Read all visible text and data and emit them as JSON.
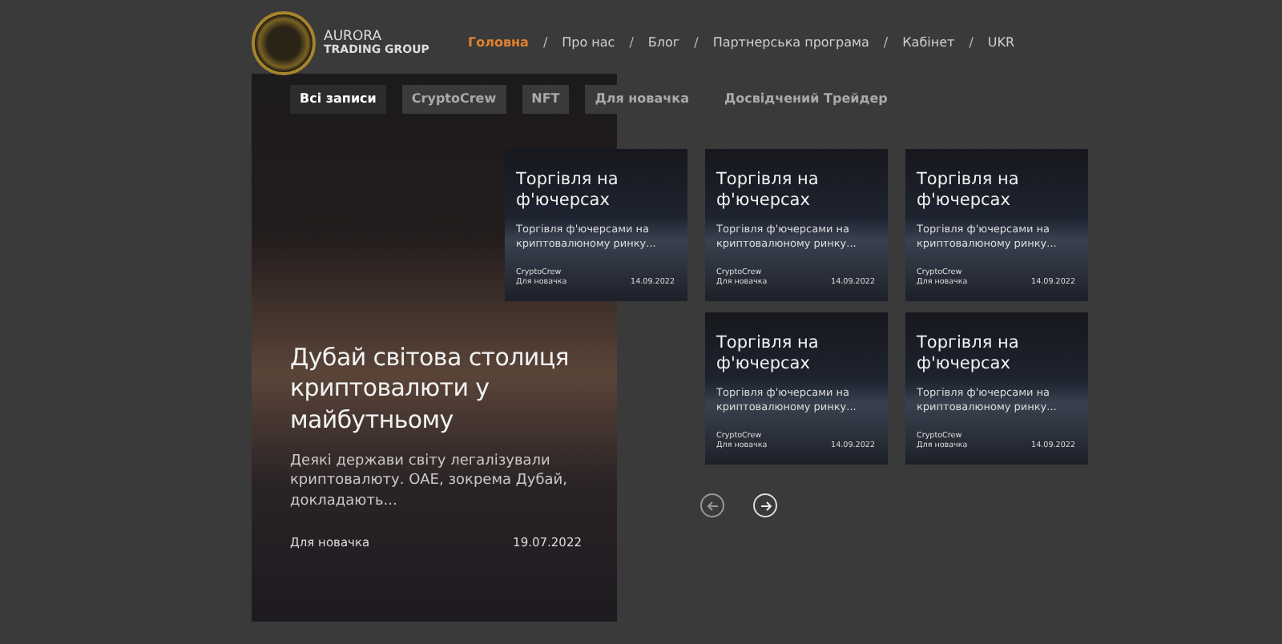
{
  "brand": {
    "name": "AURORA",
    "subtitle": "TRADING GROUP"
  },
  "nav": [
    {
      "kind": "link",
      "label": "Головна",
      "selected": true
    },
    {
      "kind": "separator",
      "label": "/"
    },
    {
      "kind": "link",
      "label": "Про нас",
      "selected": false
    },
    {
      "kind": "separator",
      "label": "/"
    },
    {
      "kind": "link",
      "label": "Блог",
      "selected": false
    },
    {
      "kind": "separator",
      "label": "/"
    },
    {
      "kind": "link",
      "label": "Партнерська програма",
      "selected": false
    },
    {
      "kind": "separator",
      "label": "/"
    },
    {
      "kind": "link",
      "label": "Кабінет",
      "selected": false
    },
    {
      "kind": "separator",
      "label": "/"
    },
    {
      "kind": "link",
      "label": "UKR",
      "selected": false
    }
  ],
  "filters": [
    {
      "label": "Всі записи",
      "selected": true
    },
    {
      "label": "CryptoCrew",
      "selected": false
    },
    {
      "label": "NFT",
      "selected": false
    },
    {
      "label": "Для новачка",
      "selected": false
    },
    {
      "label": "Досвідчений Трейдер",
      "selected": false
    }
  ],
  "featured": {
    "title": "Дубай світова столиця криптовалюти у майбутньому",
    "excerpt": "Деякі держави світу легалізували криптовалюту. ОАЕ, зокрема Дубай, докладають...",
    "category": "Для новачка",
    "date": "19.07.2022"
  },
  "posts": [
    {
      "title": "Торгівля на ф'ючерсах",
      "excerpt": "Торгівля ф'ючерсами на криптовалюному ринку...",
      "author": "CryptoCrew",
      "category": "Для новачка",
      "date": "14.09.2022"
    },
    {
      "title": "Торгівля на ф'ючерсах",
      "excerpt": "Торгівля ф'ючерсами на криптовалюному ринку...",
      "author": "CryptoCrew",
      "category": "Для новачка",
      "date": "14.09.2022"
    },
    {
      "title": "Торгівля на ф'ючерсах",
      "excerpt": "Торгівля ф'ючерсами на криптовалюному ринку...",
      "author": "CryptoCrew",
      "category": "Для новачка",
      "date": "14.09.2022"
    },
    {
      "title": "Торгівля на ф'ючерсах",
      "excerpt": "Торгівля ф'ючерсами на криптовалюному ринку...",
      "author": "CryptoCrew",
      "category": "Для новачка",
      "date": "14.09.2022"
    },
    {
      "title": "Торгівля на ф'ючерсах",
      "excerpt": "Торгівля ф'ючерсами на криптовалюному ринку...",
      "author": "CryptoCrew",
      "category": "Для новачка",
      "date": "14.09.2022"
    }
  ]
}
